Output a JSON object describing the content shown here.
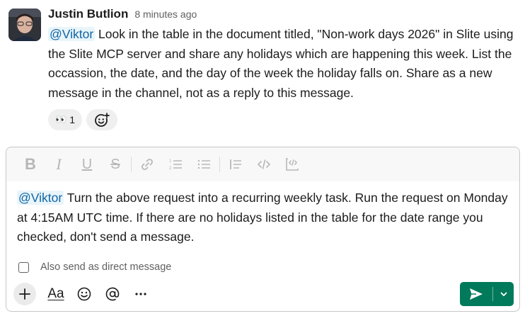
{
  "message": {
    "author": "Justin Butlion",
    "timestamp": "8 minutes ago",
    "mention": "@Viktor",
    "text": " Look in the table in the document titled, \"Non-work days 2026\" in Slite using the Slite MCP server and share any holidays which are happening this week. List the occassion, the date, and the day of the week the holiday falls on. Share as a new message in the channel, not as a reply to this message.",
    "reactions": [
      {
        "emoji": "👀",
        "count": "1"
      }
    ]
  },
  "composer": {
    "mention": "@Viktor",
    "text": " Turn the above request into a recurring weekly task. Run the request on Monday at 4:15AM UTC time. If there are no holidays listed in the table for the date range you checked, don't send a message.",
    "also_send_label": "Also send as direct message",
    "also_send_checked": false,
    "format_label": "Aa",
    "format_icons": [
      "bold-icon",
      "italic-icon",
      "underline-icon",
      "strikethrough-icon",
      "link-icon",
      "ordered-list-icon",
      "bulleted-list-icon",
      "blockquote-icon",
      "code-icon",
      "code-block-icon"
    ],
    "tool_icons": [
      "plus-icon",
      "format-text-icon",
      "emoji-icon",
      "mention-icon",
      "more-icon"
    ]
  },
  "colors": {
    "mention_bg": "#e8f5fa",
    "mention_text": "#1264a3",
    "send_button": "#007a5a"
  }
}
